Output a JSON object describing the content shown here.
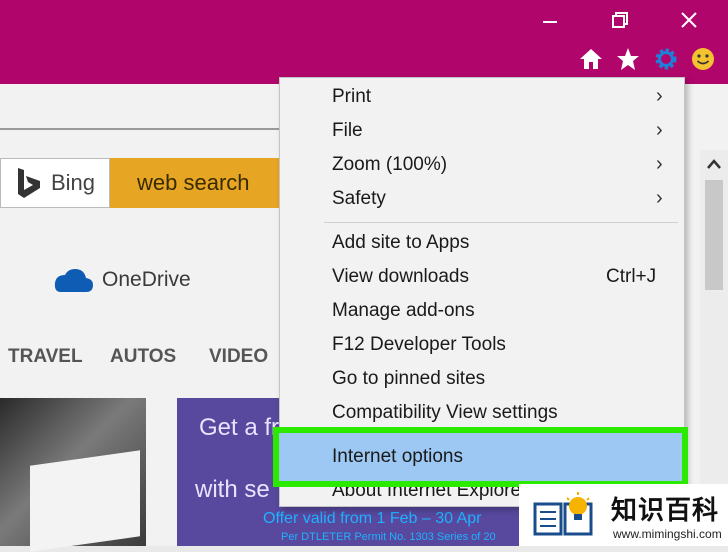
{
  "titlebar": {
    "window_buttons": [
      "minimize-icon",
      "restore-icon",
      "close-icon"
    ],
    "toolbar_icons": [
      "home-icon",
      "star-icon",
      "gear-icon",
      "smiley-icon"
    ],
    "accent_color": "#b0066c"
  },
  "search": {
    "brand": "Bing",
    "button_label": "web search"
  },
  "onedrive": {
    "label": "OneDrive"
  },
  "nav": [
    "TRAVEL",
    "AUTOS",
    "VIDEO"
  ],
  "ad": {
    "line1": "Get a fr",
    "line2": "with se",
    "line3": "Offer valid from 1 Feb – 30 Apr",
    "line4": "Per DTLETER Permit No. 1303 Series of 20"
  },
  "menu": {
    "items": [
      {
        "label": "Print",
        "submenu": true
      },
      {
        "label": "File",
        "submenu": true
      },
      {
        "label": "Zoom (100%)",
        "submenu": true
      },
      {
        "label": "Safety",
        "submenu": true
      },
      {
        "label": "Add site to Apps"
      },
      {
        "label": "View downloads",
        "shortcut": "Ctrl+J"
      },
      {
        "label": "Manage add-ons"
      },
      {
        "label": "F12 Developer Tools"
      },
      {
        "label": "Go to pinned sites"
      },
      {
        "label": "Compatibility View settings"
      },
      {
        "label": "Internet options",
        "highlighted": true
      },
      {
        "label": "About Internet Explorer"
      }
    ],
    "highlight_color": "#2bea00"
  },
  "watermark": {
    "title": "知识百科",
    "url": "www.mimingshi.com"
  }
}
